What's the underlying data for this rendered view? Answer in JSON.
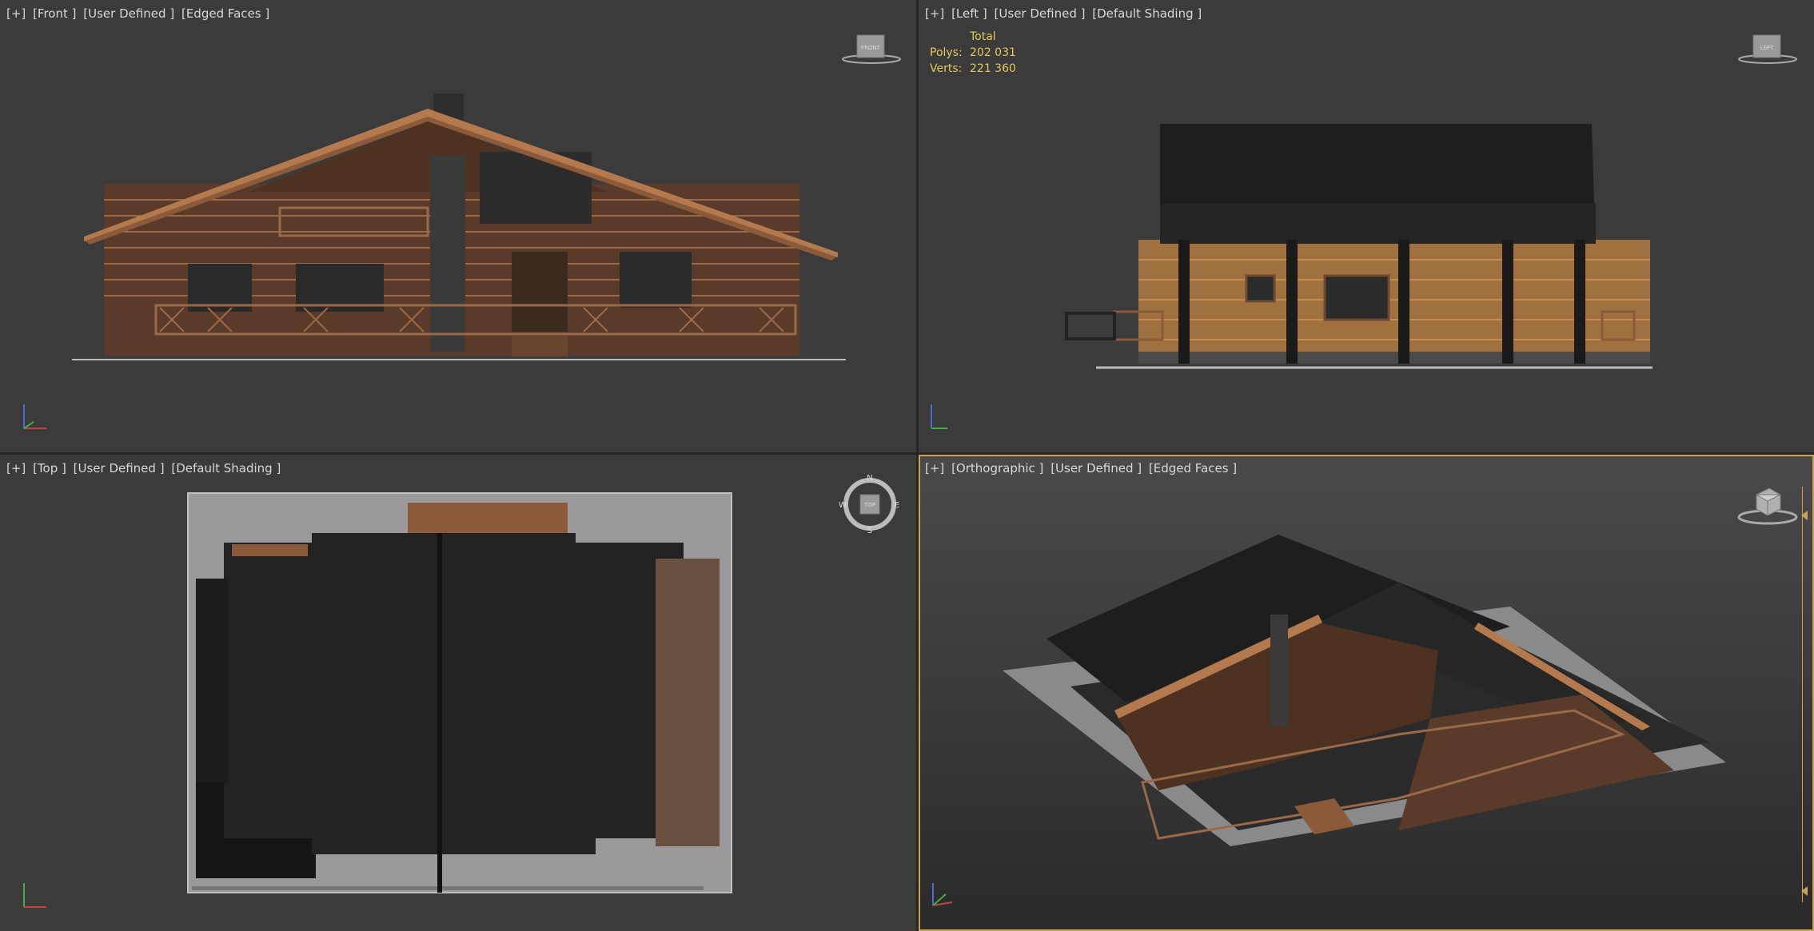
{
  "viewports": {
    "front": {
      "labels": [
        "[+]",
        "[Front ]",
        "[User Defined ]",
        "[Edged Faces ]"
      ],
      "cube": "FRONT"
    },
    "left": {
      "labels": [
        "[+]",
        "[Left ]",
        "[User Defined ]",
        "[Default Shading ]"
      ],
      "cube": "LEFT"
    },
    "top": {
      "labels": [
        "[+]",
        "[Top ]",
        "[User Defined ]",
        "[Default Shading ]"
      ],
      "cube": "TOP",
      "compass": {
        "n": "N",
        "s": "S",
        "e": "E",
        "w": "W"
      }
    },
    "persp": {
      "labels": [
        "[+]",
        "[Orthographic ]",
        "[User Defined ]",
        "[Edged Faces ]"
      ]
    }
  },
  "stats": {
    "header": "Total",
    "polys_label": "Polys:",
    "polys_value": "202 031",
    "verts_label": "Verts:",
    "verts_value": "221 360"
  },
  "colors": {
    "viewport_bg": "#3b3b3b",
    "active_border": "#c9a450",
    "stats_text": "#e4c85c",
    "wood": "#8a5a3a",
    "roof": "#1c1c1c"
  },
  "icons": [
    "viewcube-icon",
    "axis-tripod-icon",
    "compass-icon"
  ]
}
